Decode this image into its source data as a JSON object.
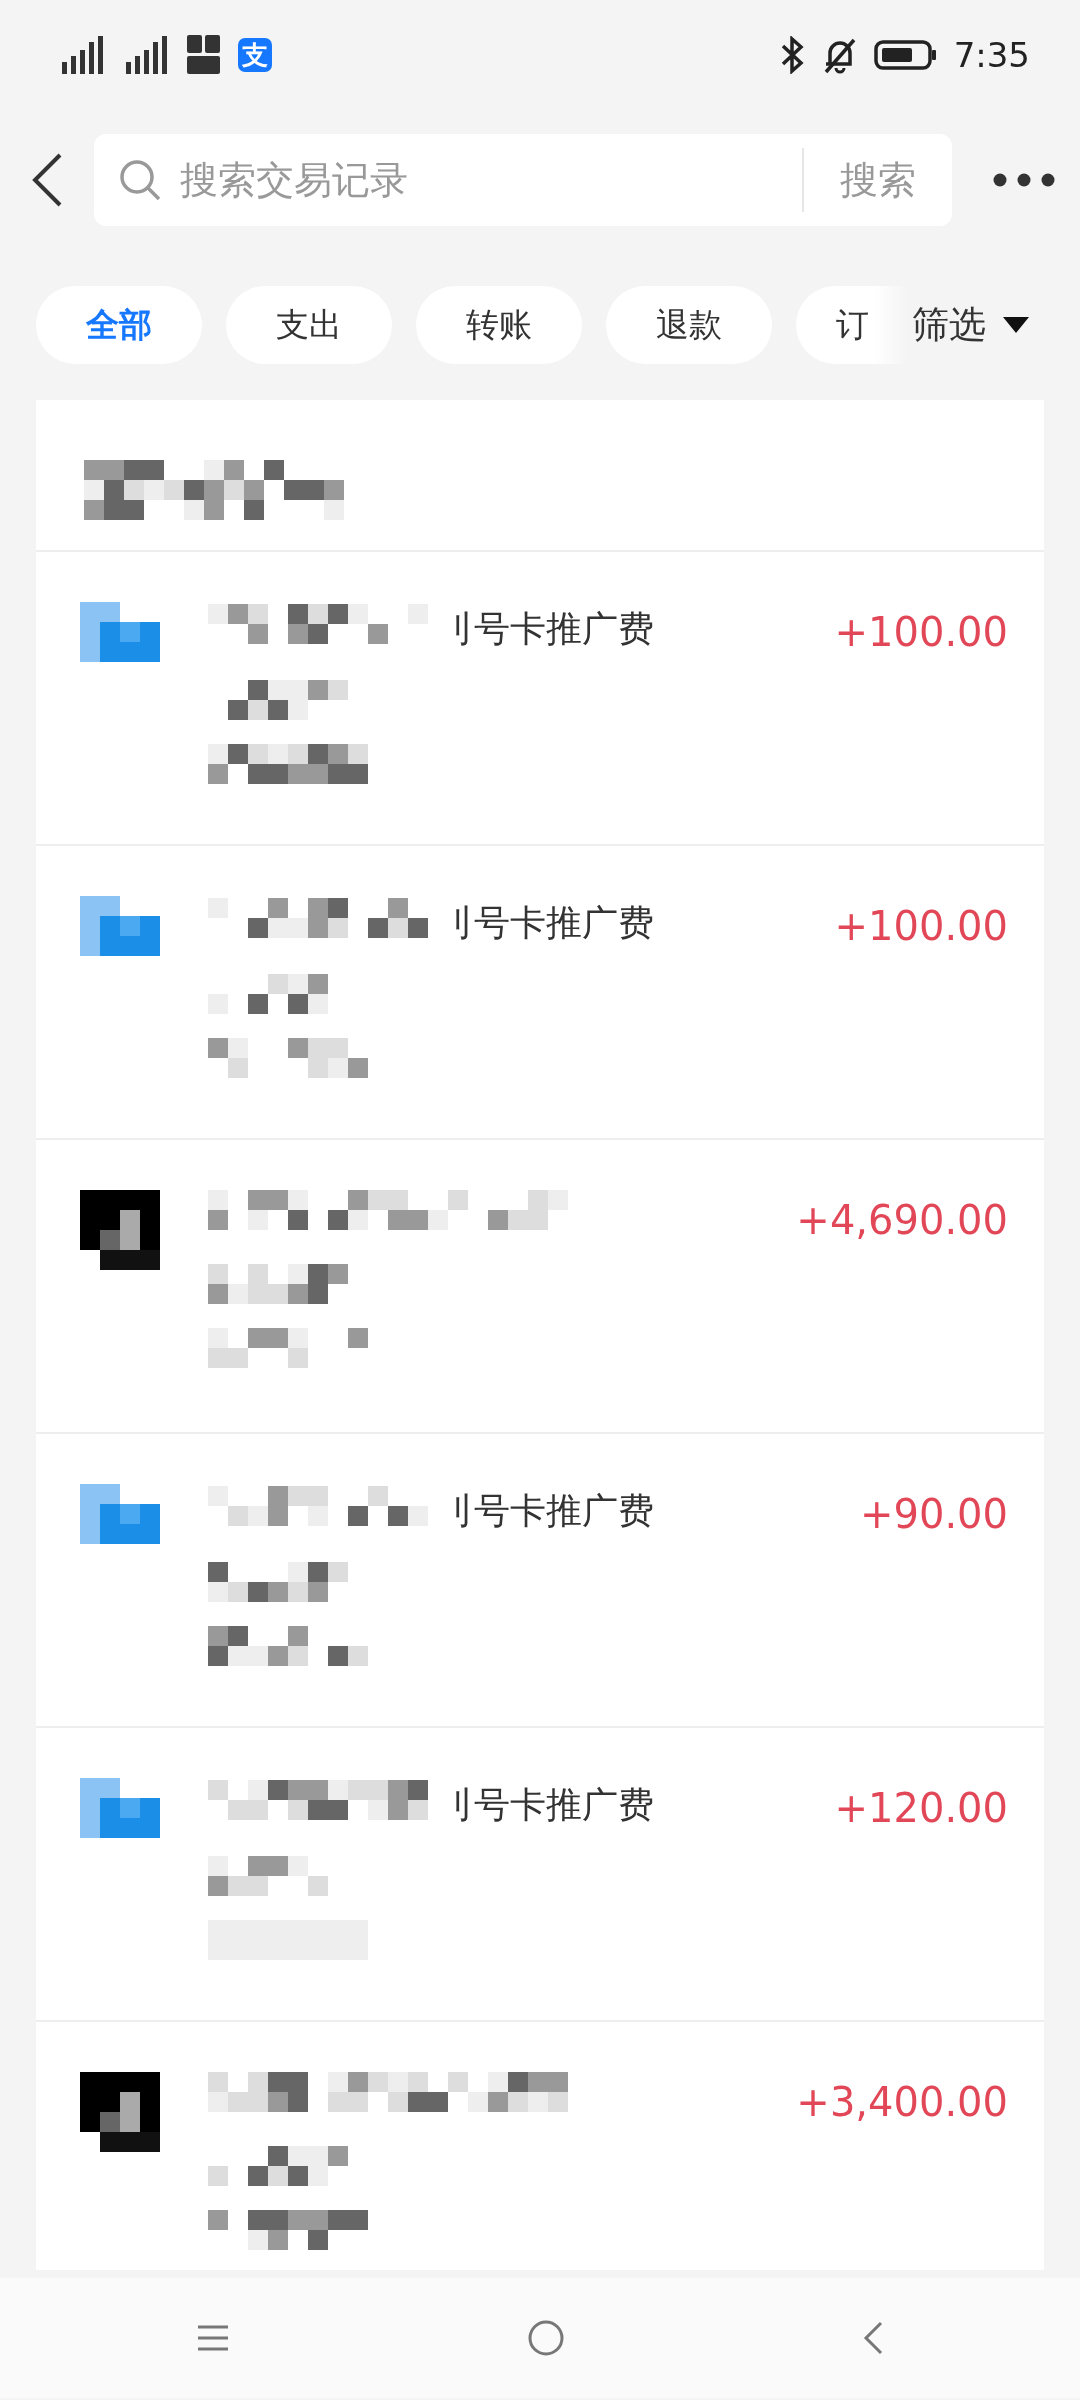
{
  "status_bar": {
    "app_badge": "支",
    "time": "7:35"
  },
  "search": {
    "placeholder": "搜索交易记录",
    "button": "搜索"
  },
  "tabs": [
    {
      "label": "全部",
      "selected": true
    },
    {
      "label": "支出",
      "selected": false
    },
    {
      "label": "转账",
      "selected": false
    },
    {
      "label": "退款",
      "selected": false
    },
    {
      "label": "订",
      "selected": false
    }
  ],
  "filter": {
    "label": "筛选"
  },
  "transactions": [
    {
      "kind": "blue",
      "title": "刂号卡推广费",
      "amount": "+100.00"
    },
    {
      "kind": "blue",
      "title": "刂号卡推广费",
      "amount": "+100.00"
    },
    {
      "kind": "dark",
      "amount": "+4,690.00"
    },
    {
      "kind": "blue",
      "title": "刂号卡推广费",
      "amount": "+90.00"
    },
    {
      "kind": "blue",
      "title": "刂号卡推广费",
      "amount": "+120.00"
    },
    {
      "kind": "dark",
      "amount": "+3,400.00"
    }
  ]
}
